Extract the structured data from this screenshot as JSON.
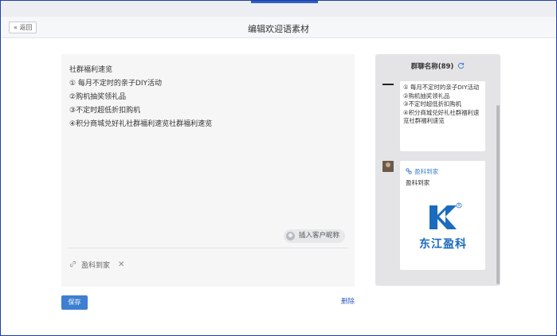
{
  "header": {
    "back_label": "« 返回",
    "title": "编辑欢迎语素材"
  },
  "editor": {
    "lines": [
      "社群福利速览",
      "① 每月不定时的亲子DIY活动",
      "②购机抽奖领礼品",
      "③不定时超低折扣购机",
      "④积分商城兑好礼社群福利速览社群福利速览"
    ],
    "insert_button_label": "插入客户昵称",
    "attachment": {
      "label": "盈科到家",
      "remove_glyph": "✕"
    }
  },
  "footer": {
    "save_label": "保存",
    "delete_label": "删除"
  },
  "preview": {
    "group_title": "群聊名称(89)",
    "message_lines": [
      "① 每月不定时的亲子DIY活动",
      "②购机抽奖领礼品",
      "③不定时超低折扣购机",
      "④积分商城兑好礼社群福利速览社群福利速览"
    ],
    "card": {
      "title": "盈科到家",
      "subtitle": "盈科到家",
      "logo_text": "东江盈科"
    }
  },
  "colors": {
    "accent": "#3d7fd1",
    "link": "#2f5fbf",
    "logo_blue": "#1b6bbf"
  },
  "icons": {
    "insert_button": "user-avatar-icon",
    "attachment": "link-icon",
    "remove": "close-icon",
    "refresh": "refresh-icon",
    "card": "mini-program-icon"
  }
}
